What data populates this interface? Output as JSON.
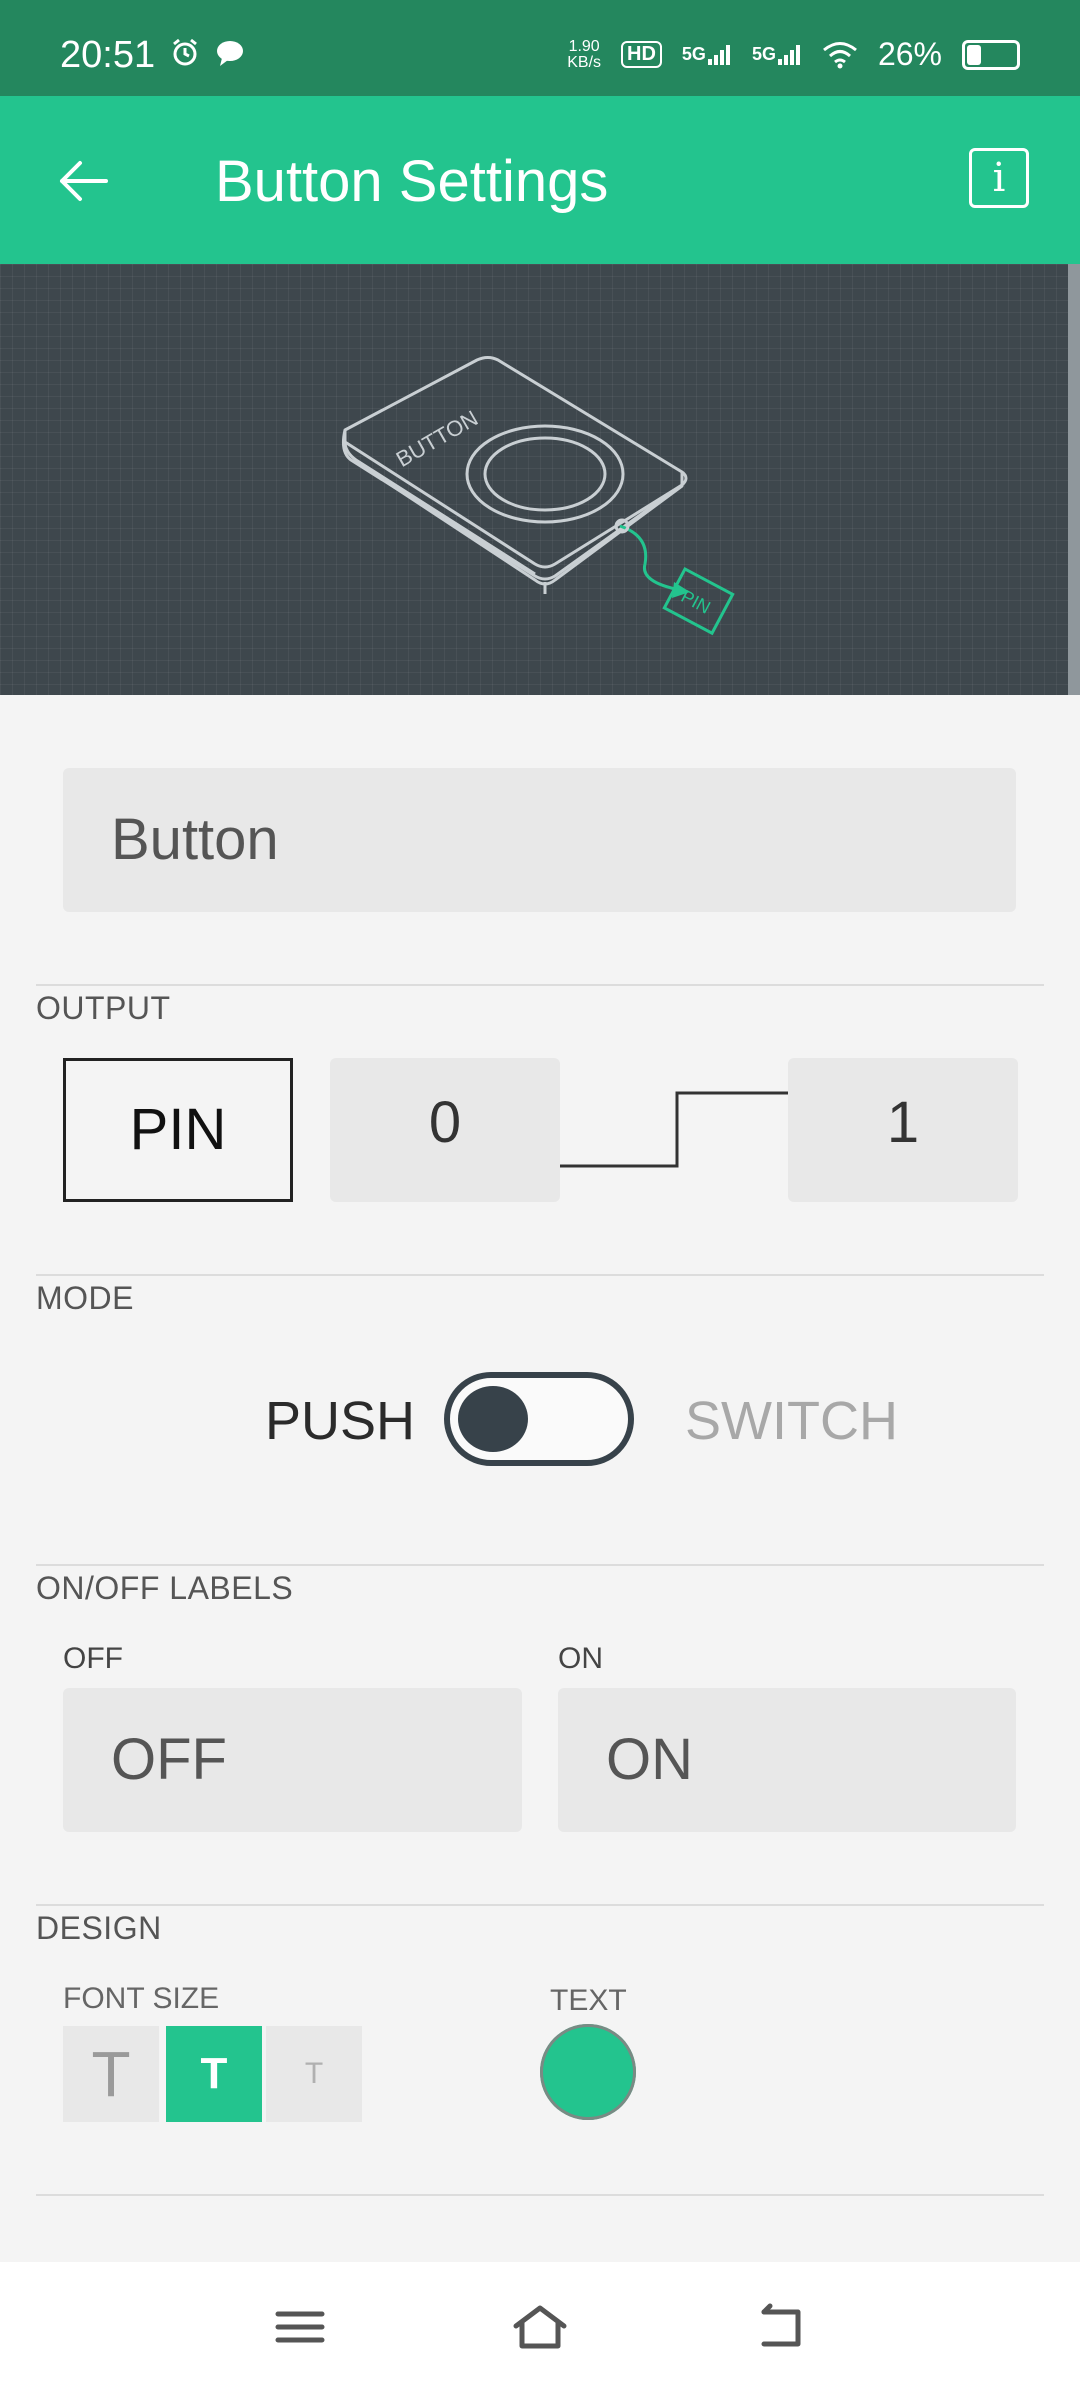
{
  "status_bar": {
    "time": "20:51",
    "net_speed_value": "1.90",
    "net_speed_unit": "KB/s",
    "hd_badge": "HD",
    "sim1_network": "5G",
    "sim2_network": "5G",
    "battery_percent": "26%",
    "battery_level": 0.26
  },
  "app_bar": {
    "title": "Button Settings",
    "info_label": "i"
  },
  "hero": {
    "device_label": "BUTTON",
    "pin_label": "PIN"
  },
  "widget_name": {
    "value": "Button"
  },
  "output": {
    "section_label": "OUTPUT",
    "pin_button_label": "PIN",
    "low_value": "0",
    "high_value": "1"
  },
  "mode": {
    "section_label": "MODE",
    "push_label": "PUSH",
    "switch_label": "SWITCH",
    "selected": "PUSH"
  },
  "labels": {
    "section_label": "ON/OFF LABELS",
    "off_label": "OFF",
    "off_value": "OFF",
    "on_label": "ON",
    "on_value": "ON"
  },
  "design": {
    "section_label": "DESIGN",
    "font_size_label": "FONT SIZE",
    "font_large_glyph": "T",
    "font_medium_glyph": "T",
    "font_small_glyph": "T",
    "selected_font_size": "medium",
    "text_label": "TEXT",
    "text_color": "#23c48e"
  },
  "colors": {
    "accent": "#23c48e",
    "status_bar": "#24875e"
  },
  "nav_bar": {
    "icons": [
      "menu-icon",
      "home-icon",
      "back-icon"
    ]
  }
}
